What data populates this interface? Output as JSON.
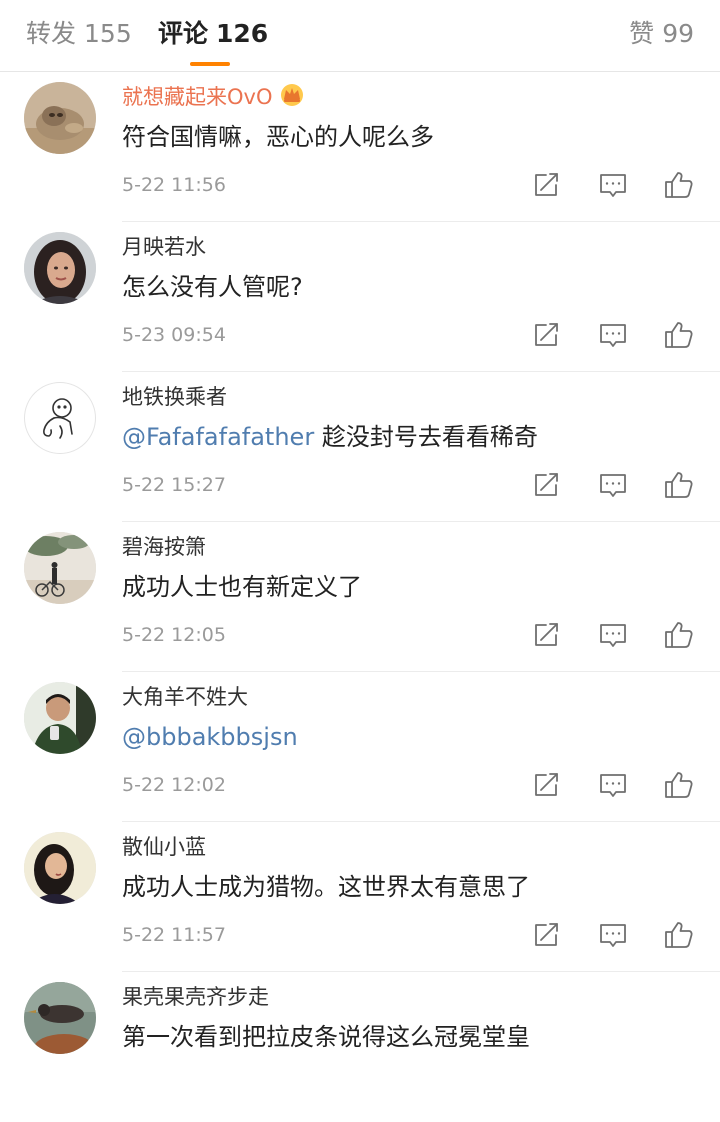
{
  "tabs": {
    "repost": {
      "label": "转发",
      "count": "155"
    },
    "comments": {
      "label": "评论",
      "count": "126"
    },
    "likes": {
      "label": "赞",
      "count": "99"
    }
  },
  "colors": {
    "accent": "#ff8200",
    "vip_name": "#eb7350",
    "mention": "#507daf",
    "meta": "#9a9a9a"
  },
  "icons": [
    "crown-icon",
    "repost-icon",
    "comment-icon",
    "like-icon"
  ],
  "comments": [
    {
      "user": "就想藏起来OvO",
      "vip": true,
      "text": "符合国情嘛，恶心的人呢么多",
      "time": "5-22 11:56"
    },
    {
      "user": "月映若水",
      "text": "怎么没有人管呢?",
      "time": "5-23 09:54"
    },
    {
      "user": "地铁换乘者",
      "mention": "@Fafafafafather",
      "text": " 趁没封号去看看稀奇",
      "time": "5-22 15:27"
    },
    {
      "user": "碧海按箫",
      "text": "成功人士也有新定义了",
      "time": "5-22 12:05"
    },
    {
      "user": "大角羊不姓大",
      "mention": "@bbbakbbsjsn",
      "text": "",
      "time": "5-22 12:02"
    },
    {
      "user": "散仙小蓝",
      "text": "成功人士成为猎物。这世界太有意思了",
      "time": "5-22 11:57"
    },
    {
      "user": "果壳果壳齐步走",
      "text": "第一次看到把拉皮条说得这么冠冕堂皇"
    }
  ]
}
